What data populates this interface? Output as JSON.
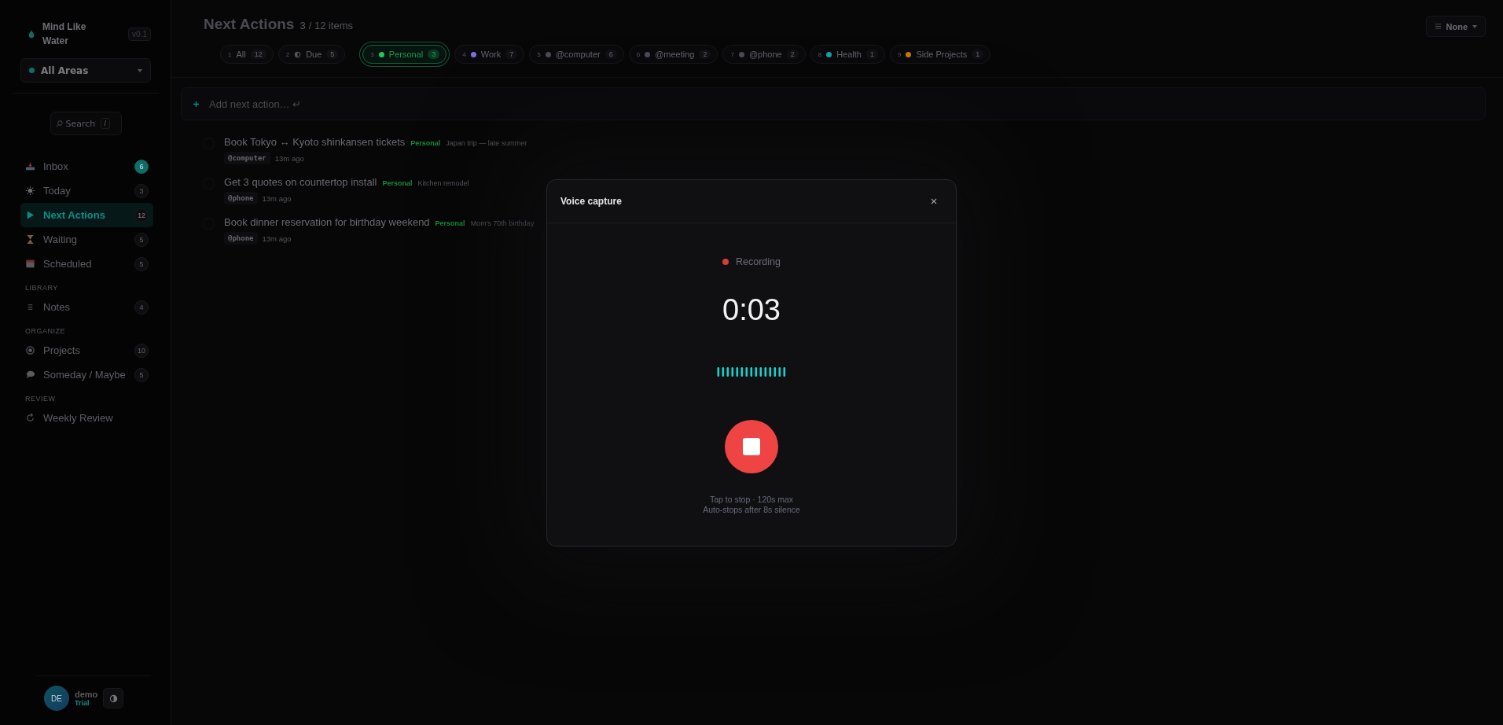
{
  "app": {
    "name": "Mind Like Water",
    "version": "v0.1"
  },
  "area_selector": {
    "label": "All Areas"
  },
  "search": {
    "placeholder": "Search",
    "shortcut": "/"
  },
  "nav": [
    {
      "items": [
        {
          "kind": "inbox",
          "label": "Inbox",
          "count": "6",
          "accent": true,
          "selected": false
        },
        {
          "kind": "today",
          "label": "Today",
          "count": "3",
          "accent": false,
          "selected": false
        },
        {
          "kind": "next",
          "label": "Next Actions",
          "count": "12",
          "accent": false,
          "selected": true
        },
        {
          "kind": "waiting",
          "label": "Waiting",
          "count": "5",
          "accent": false,
          "selected": false
        },
        {
          "kind": "scheduled",
          "label": "Scheduled",
          "count": "5",
          "accent": false,
          "selected": false
        }
      ]
    },
    {
      "heading": "LIBRARY",
      "items": [
        {
          "kind": "notes",
          "label": "Notes",
          "count": "4",
          "accent": false,
          "selected": false
        }
      ]
    },
    {
      "heading": "ORGANIZE",
      "items": [
        {
          "kind": "projects",
          "label": "Projects",
          "count": "10",
          "accent": false,
          "selected": false
        },
        {
          "kind": "someday",
          "label": "Someday / Maybe",
          "count": "5",
          "accent": false,
          "selected": false
        }
      ]
    },
    {
      "heading": "REVIEW",
      "items": [
        {
          "kind": "review",
          "label": "Weekly Review",
          "selected": false
        }
      ]
    }
  ],
  "user": {
    "initials": "DE",
    "name": "demo",
    "plan": "Trial"
  },
  "header": {
    "title": "Next Actions",
    "count": "3",
    "total": "/ 12 items",
    "grouping": "None"
  },
  "filters": [
    {
      "key": "1",
      "label": "All",
      "count": "12",
      "selected": false,
      "kind": "plain"
    },
    {
      "key": "2",
      "label": "Due",
      "count": "5",
      "selected": false,
      "kind": "due"
    },
    {
      "key": "3",
      "label": "Personal",
      "count": "3",
      "selected": true,
      "kind": "dot",
      "color": "#22c55e"
    },
    {
      "key": "4",
      "label": "Work",
      "count": "7",
      "selected": false,
      "kind": "dot",
      "color": "#7c6fd6"
    },
    {
      "key": "5",
      "label": "@computer",
      "count": "6",
      "selected": false,
      "kind": "dot",
      "color": "#4a4a58"
    },
    {
      "key": "6",
      "label": "@meeting",
      "count": "2",
      "selected": false,
      "kind": "dot",
      "color": "#4a4a58"
    },
    {
      "key": "7",
      "label": "@phone",
      "count": "2",
      "selected": false,
      "kind": "dot",
      "color": "#4a4a58"
    },
    {
      "key": "8",
      "label": "Health",
      "count": "1",
      "selected": false,
      "kind": "dot",
      "color": "#14a3a8"
    },
    {
      "key": "9",
      "label": "Side Projects",
      "count": "1",
      "selected": false,
      "kind": "dot",
      "color": "#c27612"
    }
  ],
  "add_field": {
    "placeholder": "Add next action… ↵"
  },
  "tasks": [
    {
      "title": "Book Tokyo ↔ Kyoto shinkansen tickets",
      "area": "Personal",
      "project": "Japan trip — late summer",
      "context": "@computer",
      "age": "13m ago",
      "checked": false
    },
    {
      "title": "Get 3 quotes on countertop install",
      "area": "Personal",
      "project": "Kitchen remodel",
      "context": "@phone",
      "age": "13m ago",
      "checked": false
    },
    {
      "title": "Book dinner reservation for birthday weekend",
      "area": "Personal",
      "project": "Mom's 70th birthday",
      "context": "@phone",
      "age": "13m ago",
      "checked": false
    }
  ],
  "modal": {
    "title": "Voice capture",
    "status": "Recording",
    "timer": "0:03",
    "hints": [
      "Tap to stop · 120s max",
      "Auto-stops after 8s silence"
    ]
  }
}
